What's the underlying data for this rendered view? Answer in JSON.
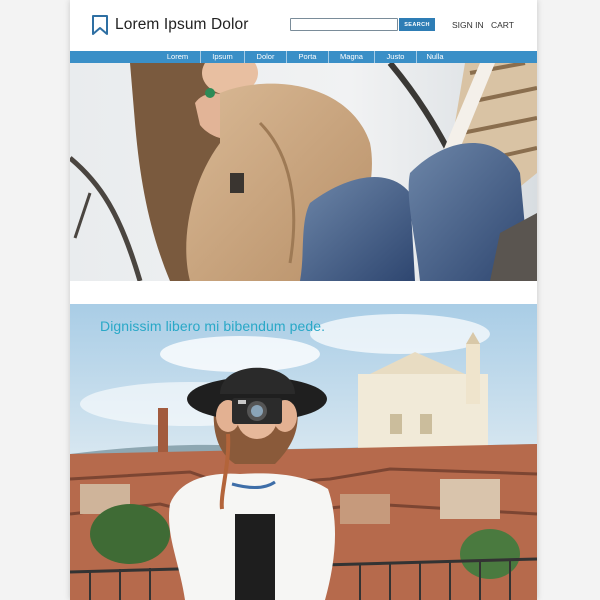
{
  "header": {
    "site_title": "Lorem Ipsum Dolor",
    "search_placeholder": "",
    "search_button": "SEARCH",
    "sign_in": "SIGN IN",
    "cart": "CART"
  },
  "nav": {
    "items": [
      {
        "label": "Lorem"
      },
      {
        "label": "Ipsum"
      },
      {
        "label": "Dolor"
      },
      {
        "label": "Porta"
      },
      {
        "label": "Magna"
      },
      {
        "label": "Justo"
      },
      {
        "label": "Nulla"
      }
    ]
  },
  "hero2": {
    "caption": "Dignissim libero mi bibendum pede."
  },
  "colors": {
    "accent": "#3a8fc7",
    "search_button": "#2e7db5",
    "caption": "#29a8c7",
    "logo": "#2e6fa3"
  }
}
